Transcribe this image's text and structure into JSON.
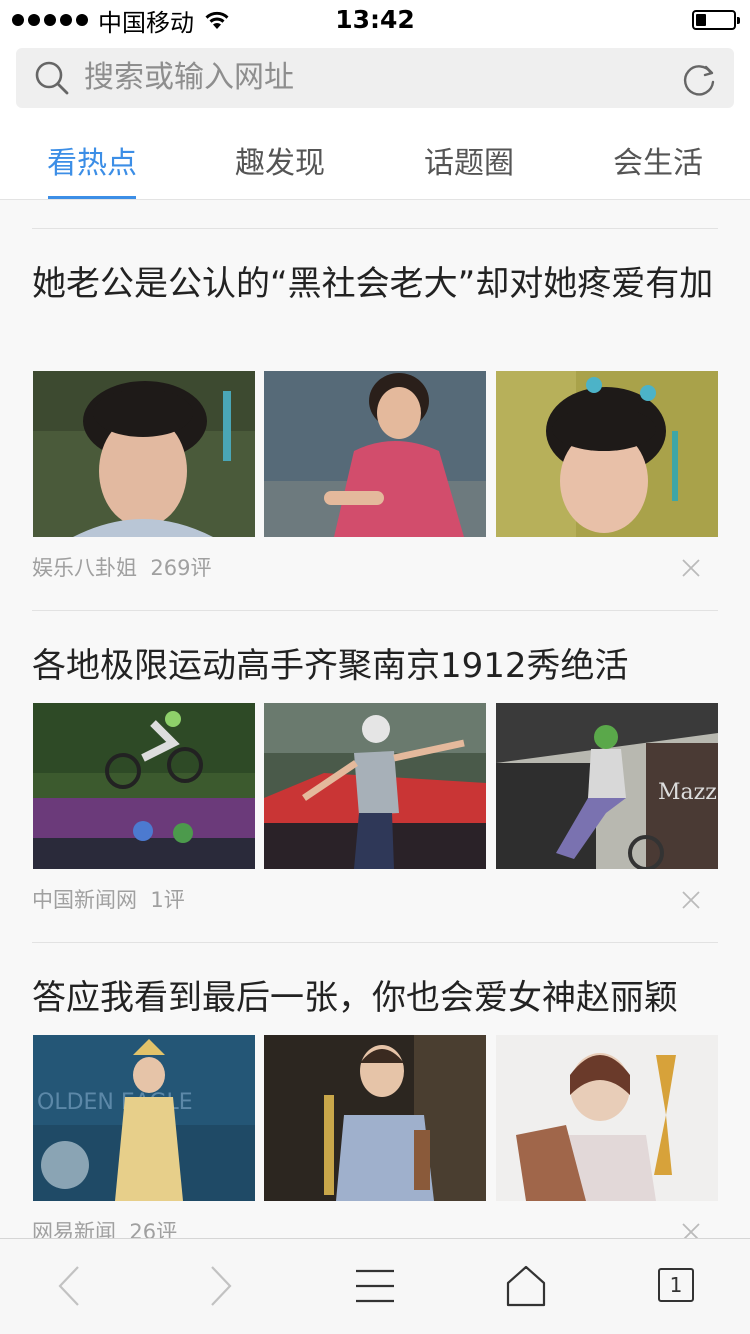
{
  "status": {
    "carrier": "中国移动",
    "time": "13:42",
    "signal_bars": 5,
    "battery_level": 0.25
  },
  "search": {
    "placeholder": "搜索或输入网址",
    "search_icon": "search-icon",
    "refresh_icon": "refresh-icon"
  },
  "tabs": [
    {
      "label": "看热点",
      "active": true
    },
    {
      "label": "趣发现",
      "active": false
    },
    {
      "label": "话题圈",
      "active": false
    },
    {
      "label": "会生活",
      "active": false
    }
  ],
  "colors": {
    "accent": "#3c8ee6",
    "meta_text": "#a0a0a0",
    "headline_text": "#222222"
  },
  "feed": [
    {
      "title": "她老公是公认的“黑社会老大”却对她疼爱有加",
      "source": "娱乐八卦姐",
      "comments": "269评",
      "images": [
        "woman-in-period-costume-photo",
        "woman-in-red-dress-sitting-photo",
        "woman-in-period-costume-closeup-photo"
      ]
    },
    {
      "title": "各地极限运动高手齐聚南京1912秀绝活",
      "source": "中国新闻网",
      "comments": "1评",
      "images": [
        "bmx-rider-jump-photo",
        "bmx-rider-stage-photo",
        "bmx-rider-street-photo"
      ]
    },
    {
      "title": "答应我看到最后一张，你也会爱女神赵丽颖",
      "source": "网易新闻",
      "comments": "26评",
      "images": [
        "actress-gold-gown-photo",
        "actress-with-trophy-photo",
        "actress-holding-award-photo"
      ]
    }
  ],
  "toolbar": {
    "back_icon": "back-chevron-icon",
    "forward_icon": "forward-chevron-icon",
    "menu_icon": "menu-icon",
    "home_icon": "home-icon",
    "tab_count": "1"
  }
}
